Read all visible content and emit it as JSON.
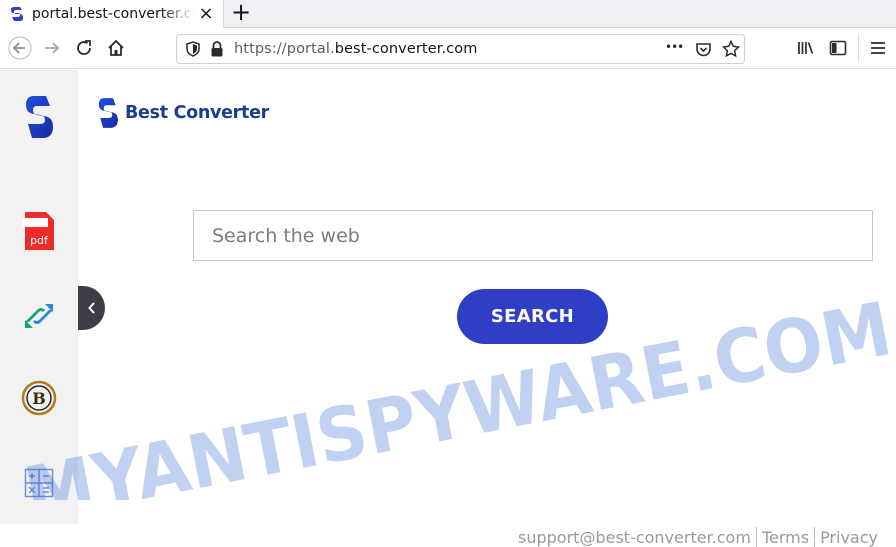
{
  "tab": {
    "title": "portal.best-converter.com",
    "close_glyph": "×",
    "favicon": "best-converter-s-icon"
  },
  "new_tab_glyph": "+",
  "navbar": {
    "url_prefix": "https://portal.",
    "url_domain": "best-converter.com",
    "more_glyph": "•••"
  },
  "page": {
    "logo_text": "Best Converter",
    "search_placeholder": "Search the web",
    "search_button": "SEARCH",
    "sidebar_items": [
      {
        "name": "pdf-converter",
        "label": "pdf"
      },
      {
        "name": "file-converter"
      },
      {
        "name": "bitcoin-converter",
        "label": "B"
      },
      {
        "name": "calculator"
      }
    ],
    "footer": {
      "email": "support@best-converter.com",
      "terms": "Terms",
      "privacy": "Privacy"
    }
  },
  "watermark": "MYANTISPYWARE.COM",
  "colors": {
    "brand": "#1d3c8f",
    "button": "#2f3fc4",
    "watermark": "#3a6fd8"
  }
}
